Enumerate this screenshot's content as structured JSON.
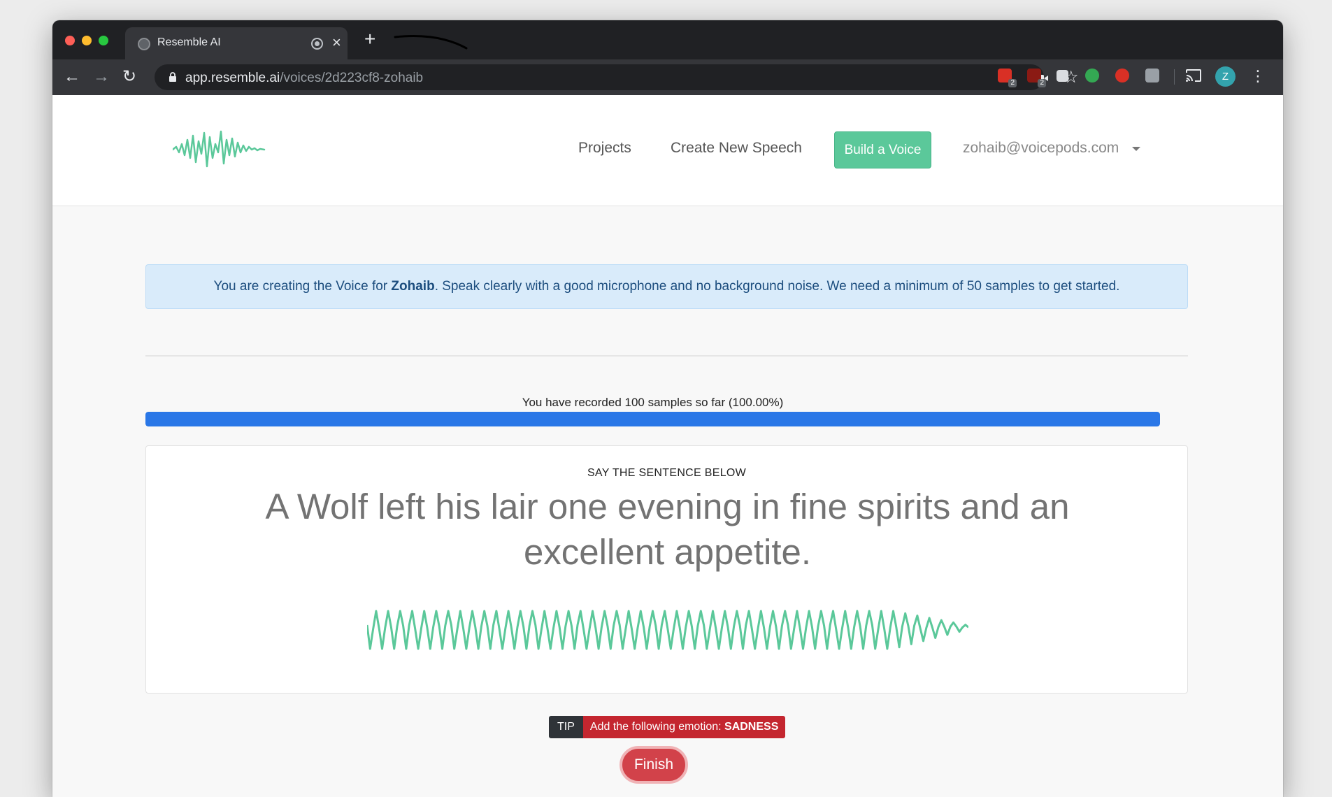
{
  "browser": {
    "tab_title": "Resemble AI",
    "tab_close": "×",
    "new_tab": "+",
    "url_host": "app.resemble.ai",
    "url_path": "/voices/2d223cf8-zohaib",
    "extension_badges": [
      "2",
      "2"
    ],
    "profile_initial": "Z",
    "icons": [
      "back-icon",
      "forward-icon",
      "reload-icon",
      "lock-icon",
      "camera-icon",
      "star-icon",
      "cast-icon",
      "kebab-menu-icon"
    ]
  },
  "nav": {
    "projects": "Projects",
    "create_speech": "Create New Speech",
    "build_voice": "Build a Voice",
    "user_email": "zohaib@voicepods.com"
  },
  "alert": {
    "before": "You are creating the Voice for ",
    "name": "Zohaib",
    "after": ". Speak clearly with a good microphone and no background noise. We need a minimum of 50 samples to get started."
  },
  "progress": {
    "label": "You have recorded 100 samples so far (100.00%)",
    "fraction": 1.0
  },
  "card": {
    "title": "SAY THE SENTENCE BELOW",
    "sentence": "A Wolf left his lair one evening in fine spirits and an excellent appetite."
  },
  "tip": {
    "label": "TIP",
    "text": "Add the following emotion: ",
    "emotion": "SADNESS"
  },
  "finish_button": "Finish",
  "colors": {
    "brand_green": "#5bc89a",
    "progress_blue": "#2a77e7",
    "danger_red": "#d2424a"
  }
}
